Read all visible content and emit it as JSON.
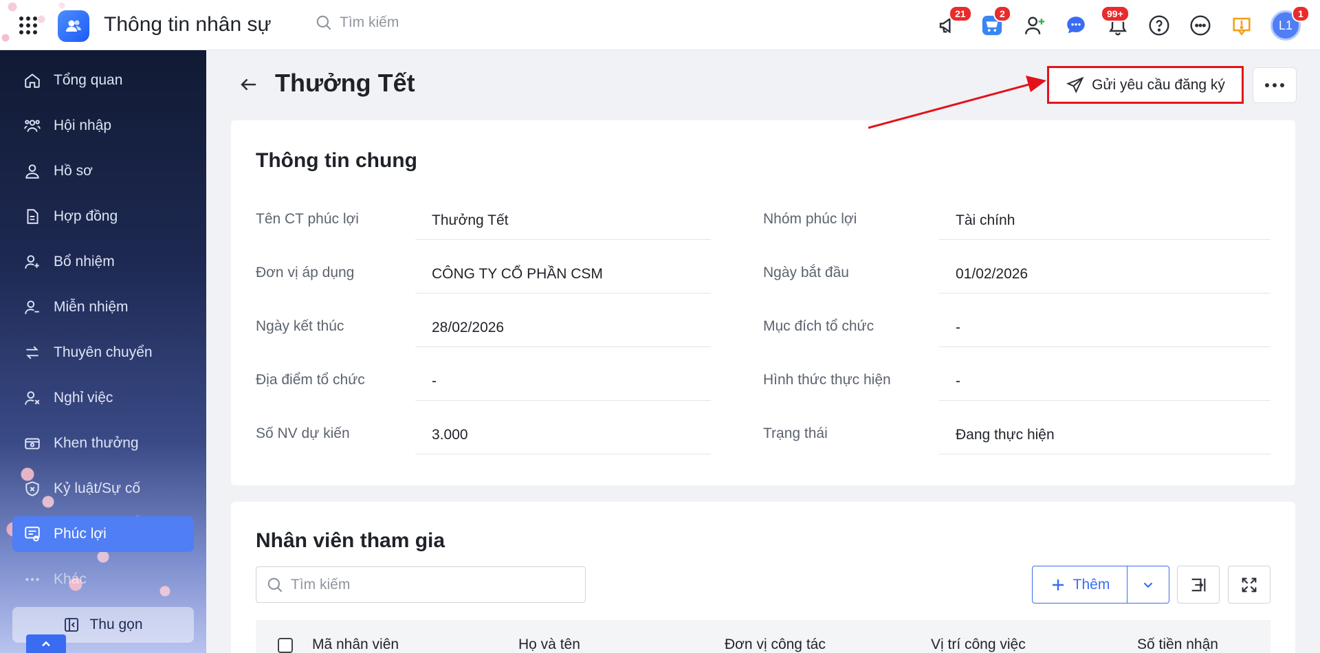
{
  "topbar": {
    "app_title": "Thông tin nhân sự",
    "search_placeholder": "Tìm kiếm",
    "badges": {
      "announcements": "21",
      "cart": "2",
      "notifications": "99+",
      "avatar": "1"
    },
    "avatar_initials": "L1"
  },
  "sidebar": {
    "items": [
      {
        "label": "Tổng quan",
        "icon": "home-icon"
      },
      {
        "label": "Hội nhập",
        "icon": "users-icon"
      },
      {
        "label": "Hồ sơ",
        "icon": "user-icon"
      },
      {
        "label": "Hợp đồng",
        "icon": "document-icon"
      },
      {
        "label": "Bổ nhiệm",
        "icon": "user-plus-icon"
      },
      {
        "label": "Miễn nhiệm",
        "icon": "user-minus-icon"
      },
      {
        "label": "Thuyên chuyển",
        "icon": "transfer-icon"
      },
      {
        "label": "Nghỉ việc",
        "icon": "user-x-icon"
      },
      {
        "label": "Khen thưởng",
        "icon": "award-icon"
      },
      {
        "label": "Kỷ luật/Sự cố",
        "icon": "shield-icon"
      },
      {
        "label": "Phúc lợi",
        "icon": "benefit-icon",
        "active": true
      },
      {
        "label": "Khác",
        "icon": "more-dots-icon"
      }
    ],
    "collapse_label": "Thu gọn"
  },
  "page": {
    "title": "Thưởng Tết",
    "send_request_label": "Gửi yêu cầu đăng ký"
  },
  "general_info": {
    "title": "Thông tin chung",
    "left_fields": [
      {
        "label": "Tên CT phúc lợi",
        "value": "Thưởng Tết"
      },
      {
        "label": "Đơn vị áp dụng",
        "value": "CÔNG TY CỔ PHẦN CSM"
      },
      {
        "label": "Ngày kết thúc",
        "value": "28/02/2026"
      },
      {
        "label": "Địa điểm tổ chức",
        "value": "-"
      },
      {
        "label": "Số NV dự kiến",
        "value": "3.000"
      }
    ],
    "right_fields": [
      {
        "label": "Nhóm phúc lợi",
        "value": "Tài chính"
      },
      {
        "label": "Ngày bắt đầu",
        "value": "01/02/2026"
      },
      {
        "label": "Mục đích tổ chức",
        "value": "-"
      },
      {
        "label": "Hình thức thực hiện",
        "value": "-"
      },
      {
        "label": "Trạng thái",
        "value": "Đang thực hiện"
      }
    ]
  },
  "participants": {
    "title": "Nhân viên tham gia",
    "search_placeholder": "Tìm kiếm",
    "add_label": "Thêm",
    "columns": [
      "Mã nhân viên",
      "Họ và tên",
      "Đơn vị công tác",
      "Vị trí công việc",
      "Số tiền nhận"
    ]
  },
  "colors": {
    "accent": "#3a6cf2",
    "highlight_border": "#e3121a",
    "badge": "#ea2b2b"
  }
}
